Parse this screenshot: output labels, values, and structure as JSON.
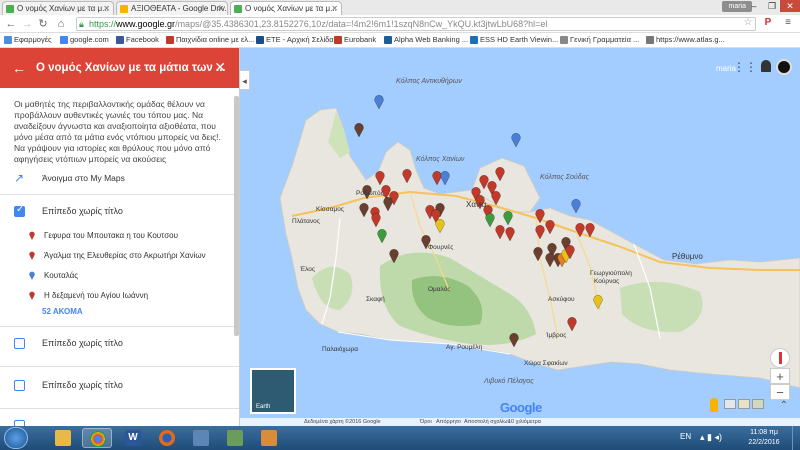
{
  "browser": {
    "tabs": [
      {
        "title": "Ο νομός Χανίων με τα μ...",
        "active": false,
        "icon": "maps-icon"
      },
      {
        "title": "ΑΞΙΟΘΕΑΤΑ - Google Driv...",
        "active": false,
        "icon": "drive-icon"
      },
      {
        "title": "Ο νομός Χανίων με τα μ...",
        "active": true,
        "icon": "maps-icon"
      }
    ],
    "user_chip": "maria",
    "url_scheme": "https://",
    "url_host": "www.google.gr",
    "url_path": "/maps/@35.4386301,23.8152276,10z/data=!4m2!6m1!1szqN8nCw_YkQU.kt3jtwLbU68?hl=el",
    "bookmarks": [
      {
        "label": "Εφαρμογές",
        "color": "#4a90d9"
      },
      {
        "label": "google.com",
        "color": "#4285f4"
      },
      {
        "label": "Facebook",
        "color": "#3b5998"
      },
      {
        "label": "Παιχνίδια online με ελ...",
        "color": "#c0392b"
      },
      {
        "label": "ΕΤΕ - Αρχική Σελίδα",
        "color": "#1a4e8a"
      },
      {
        "label": "Eurobank",
        "color": "#c0392b"
      },
      {
        "label": "Alpha Web Banking ...",
        "color": "#1a5e9a"
      },
      {
        "label": "ESS HD Earth Viewin...",
        "color": "#1d6fb8"
      },
      {
        "label": "Γενική Γραμματεία ...",
        "color": "#888888"
      },
      {
        "label": "https://www.atlas.g...",
        "color": "#777777"
      }
    ]
  },
  "panel": {
    "title": "Ο νομός Χανίων με τα μάτια των ...",
    "description": "Οι μαθητές της περιβαλλοντικής ομάδας θέλουν να προβάλλουν αυθεντικές γωνιές του τόπου μας. Να αναδείξουν άγνωστα και αναξιοποίητα αξιοθέατα, που μόνο μέσα από τα μάτια ενός ντόπιου μπορείς να δεις!. Να γράψουν για ιστορίες και θρύλους που μόνο από αφηγήσεις ντόπιων μπορείς να ακούσεις",
    "open_label": "Άνοιγμα στο My Maps",
    "layers": [
      {
        "label": "Επίπεδο χωρίς τίτλο",
        "checked": true
      },
      {
        "label": "Επίπεδο χωρίς τίτλο",
        "checked": false
      },
      {
        "label": "Επίπεδο χωρίς τίτλο",
        "checked": false
      }
    ],
    "items": [
      {
        "label": "Γεφυρα του Μπουτακα η του Κουτσου",
        "color": "#c0392b"
      },
      {
        "label": "Άγαλμα της Ελευθερίας στο Ακρωτήρι Χανίων",
        "color": "#c0392b"
      },
      {
        "label": "Κουταλάς",
        "color": "#4a7fd4"
      },
      {
        "label": "Η δεξαμενή του Αγίου Ιωάννη",
        "color": "#c0392b"
      }
    ],
    "more_label": "52 ΑΚΟΜΑ"
  },
  "map": {
    "user_name": "maria",
    "google_label": "Google",
    "earth_label": "Earth",
    "labels": {
      "sea_north": "Κόλπος Αντικυθήρων",
      "gulf_chania": "Κόλπος Χανίων",
      "gulf_souda": "Κόλπος Σούδας",
      "sea_libyan": "Λιβυκό Πέλαγος",
      "kissamos": "Κίσσαμος",
      "platanos": "Πλάτανος",
      "rodopos": "Ροδωπός",
      "elos": "Έλος",
      "paleochora": "Παλαιόχωρα",
      "sfakia": "Χώρα Σφακίων",
      "rethymno": "Ρέθυμνο",
      "imbros": "Ίμβρος",
      "omalos": "Ομαλός",
      "kournas": "Κούρνας",
      "georgioupoli": "Γεωργιούπολη",
      "askyfou": "Ασκύφου",
      "skafi": "Σκαφή",
      "agia_roumeli": "Αγ. Ρουμέλη",
      "chania": "Χανιά",
      "fournes": "Φουρνές"
    },
    "footer": [
      "Δεδομένα χάρτη ©2016 Google",
      "Όροι",
      "Απόρρητο",
      "Αποστολή σχολίων",
      "10 χιλιόμετρα"
    ]
  },
  "taskbar": {
    "lang": "EN",
    "time": "11:08 πμ",
    "date": "22/2/2016"
  }
}
